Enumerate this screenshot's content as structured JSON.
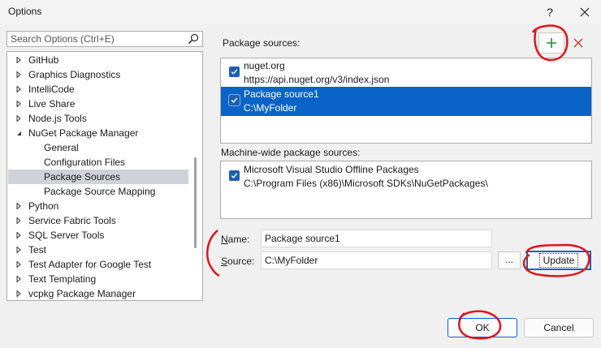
{
  "window": {
    "title": "Options",
    "help_label": "?"
  },
  "search": {
    "placeholder": "Search Options (Ctrl+E)"
  },
  "tree": {
    "items": [
      {
        "label": "GitHub"
      },
      {
        "label": "Graphics Diagnostics"
      },
      {
        "label": "IntelliCode"
      },
      {
        "label": "Live Share"
      },
      {
        "label": "Node.js Tools"
      },
      {
        "label": "NuGet Package Manager"
      },
      {
        "label": "General"
      },
      {
        "label": "Configuration Files"
      },
      {
        "label": "Package Sources"
      },
      {
        "label": "Package Source Mapping"
      },
      {
        "label": "Python"
      },
      {
        "label": "Service Fabric Tools"
      },
      {
        "label": "SQL Server Tools"
      },
      {
        "label": "Test"
      },
      {
        "label": "Test Adapter for Google Test"
      },
      {
        "label": "Text Templating"
      },
      {
        "label": "vcpkg Package Manager"
      }
    ]
  },
  "package_sources": {
    "label": "Package sources:",
    "items": [
      {
        "name": "nuget.org",
        "url": "https://api.nuget.org/v3/index.json"
      },
      {
        "name": "Package source1",
        "url": "C:\\MyFolder"
      }
    ]
  },
  "machine_sources": {
    "label": "Machine-wide package sources:",
    "items": [
      {
        "name": "Microsoft Visual Studio Offline Packages",
        "url": "C:\\Program Files (x86)\\Microsoft SDKs\\NuGetPackages\\"
      }
    ]
  },
  "form": {
    "name_label_key": "N",
    "name_label_rest": "ame:",
    "name_value": "Package source1",
    "source_label_key": "S",
    "source_label_rest": "ource:",
    "source_value": "C:\\MyFolder",
    "browse_label": "...",
    "update_label": "Update"
  },
  "buttons": {
    "ok": "OK",
    "cancel": "Cancel"
  },
  "colors": {
    "accent": "#0a64c8",
    "annotation": "#e0151b",
    "add_icon": "#2e8b2e"
  }
}
